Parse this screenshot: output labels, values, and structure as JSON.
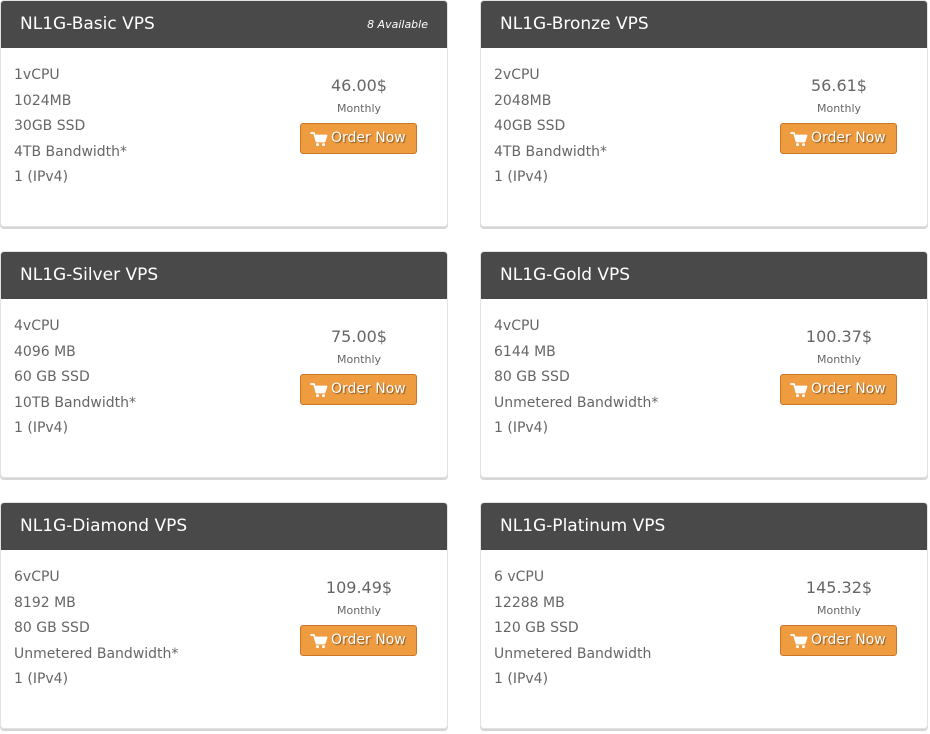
{
  "colors": {
    "header_bg": "#494949",
    "button_bg": "#ef9b3f",
    "text": "#666666"
  },
  "icons": {
    "order": "cart-icon"
  },
  "cards": [
    {
      "title": "NL1G-Basic VPS",
      "availability": "8 Available",
      "features": [
        "1vCPU",
        "1024MB",
        "30GB SSD",
        "4TB Bandwidth*",
        "1 (IPv4)"
      ],
      "price": "46.00$",
      "cycle": "Monthly",
      "button": "Order Now"
    },
    {
      "title": "NL1G-Bronze VPS",
      "availability": "",
      "features": [
        "2vCPU",
        "2048MB",
        "40GB SSD",
        "4TB Bandwidth*",
        "1 (IPv4)"
      ],
      "price": "56.61$",
      "cycle": "Monthly",
      "button": "Order Now"
    },
    {
      "title": "NL1G-Silver VPS",
      "availability": "",
      "features": [
        "4vCPU",
        "4096 MB",
        "60 GB SSD",
        "10TB Bandwidth*",
        "1 (IPv4)"
      ],
      "price": "75.00$",
      "cycle": "Monthly",
      "button": "Order Now"
    },
    {
      "title": "NL1G-Gold VPS",
      "availability": "",
      "features": [
        "4vCPU",
        "6144 MB",
        "80 GB SSD",
        "Unmetered Bandwidth*",
        "1 (IPv4)"
      ],
      "price": "100.37$",
      "cycle": "Monthly",
      "button": "Order Now"
    },
    {
      "title": "NL1G-Diamond VPS",
      "availability": "",
      "features": [
        "6vCPU",
        "8192 MB",
        "80 GB SSD",
        "Unmetered Bandwidth*",
        "1 (IPv4)"
      ],
      "price": "109.49$",
      "cycle": "Monthly",
      "button": "Order Now"
    },
    {
      "title": "NL1G-Platinum VPS",
      "availability": "",
      "features": [
        "6 vCPU",
        "12288 MB",
        "120 GB SSD",
        "Unmetered Bandwidth",
        "1 (IPv4)"
      ],
      "price": "145.32$",
      "cycle": "Monthly",
      "button": "Order Now"
    }
  ]
}
